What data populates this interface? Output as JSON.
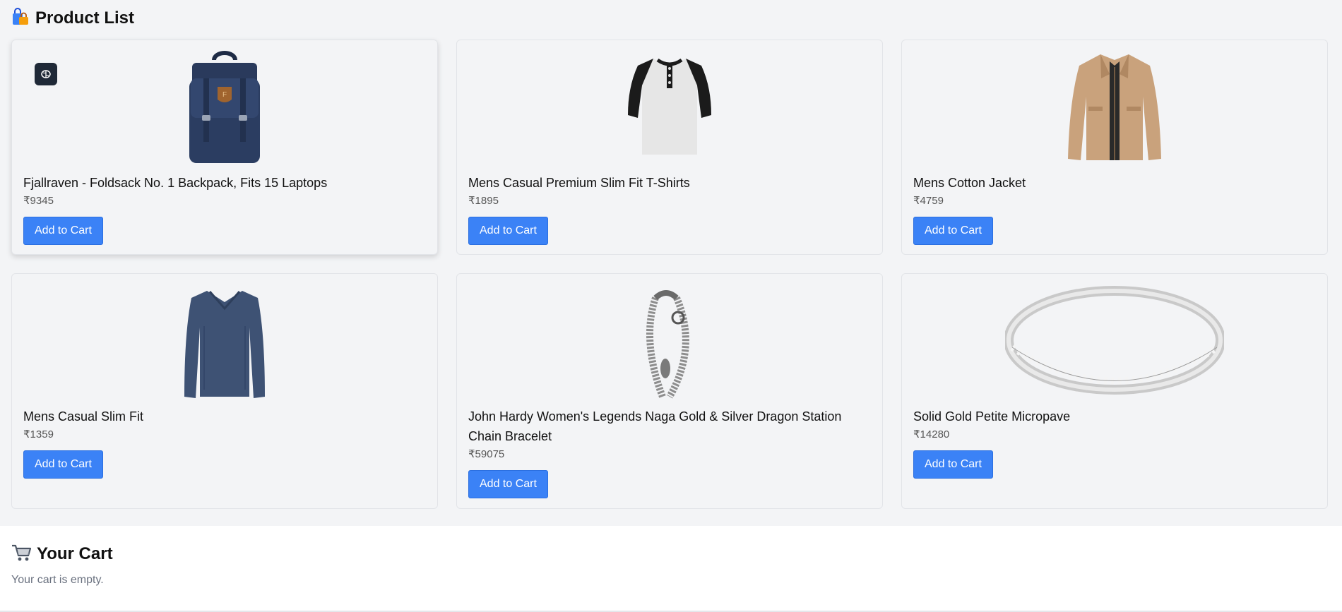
{
  "header": {
    "title": "Product List",
    "icon": "shopping-bags-icon"
  },
  "products": [
    {
      "title": "Fjallraven - Foldsack No. 1 Backpack, Fits 15 Laptops",
      "price": "₹9345",
      "button": "Add to Cart",
      "image": "backpack"
    },
    {
      "title": "Mens Casual Premium Slim Fit T-Shirts",
      "price": "₹1895",
      "button": "Add to Cart",
      "image": "tshirt"
    },
    {
      "title": "Mens Cotton Jacket",
      "price": "₹4759",
      "button": "Add to Cart",
      "image": "jacket"
    },
    {
      "title": "Mens Casual Slim Fit",
      "price": "₹1359",
      "button": "Add to Cart",
      "image": "longsleeve"
    },
    {
      "title": "John Hardy Women's Legends Naga Gold & Silver Dragon Station Chain Bracelet",
      "price": "₹59075",
      "button": "Add to Cart",
      "image": "bracelet"
    },
    {
      "title": "Solid Gold Petite Micropave",
      "price": "₹14280",
      "button": "Add to Cart",
      "image": "ring"
    }
  ],
  "cart": {
    "title": "Your Cart",
    "icon": "shopping-cart-icon",
    "empty_message": "Your cart is empty."
  },
  "colors": {
    "accent": "#3b82f6",
    "background": "#f3f4f6"
  }
}
